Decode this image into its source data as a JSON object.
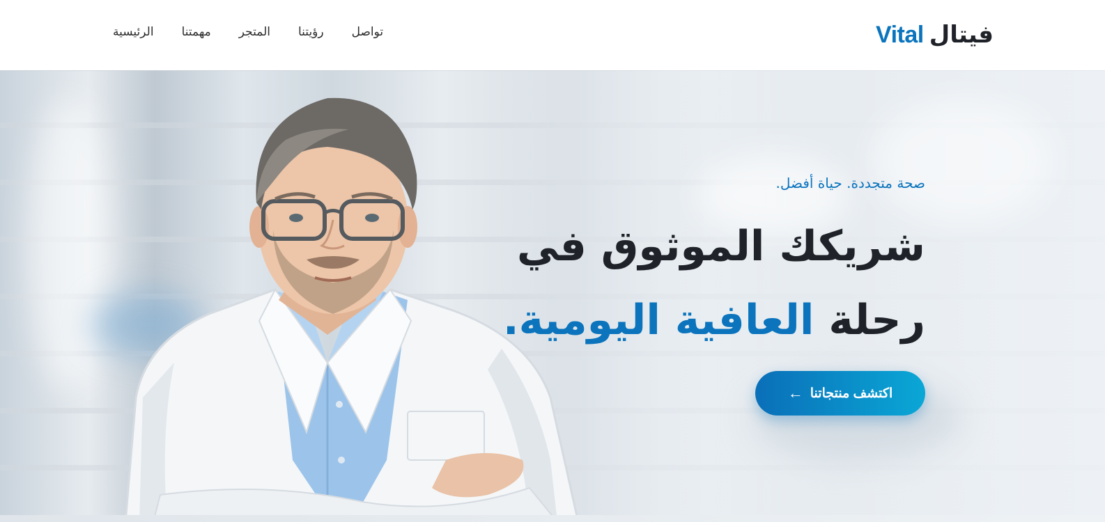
{
  "brand": {
    "name_arabic": "فيتال",
    "name_latin": "Vital",
    "accent_color": "#0b74bd",
    "dark_color": "#1f2329"
  },
  "nav": {
    "items": [
      {
        "label": "الرئيسية"
      },
      {
        "label": "مهمتنا"
      },
      {
        "label": "المتجر"
      },
      {
        "label": "رؤيتنا"
      },
      {
        "label": "تواصل"
      }
    ]
  },
  "hero": {
    "tagline": "صحة متجددة. حياة أفضل.",
    "headline_line1": "شريكك الموثوق في",
    "headline_line2_plain": "رحلة",
    "headline_line2_accent": "العافية اليومية.",
    "cta_label": "اكتشف منتجاتنا",
    "cta_icon": "arrow-left-icon",
    "image": "pharmacist-portrait"
  }
}
